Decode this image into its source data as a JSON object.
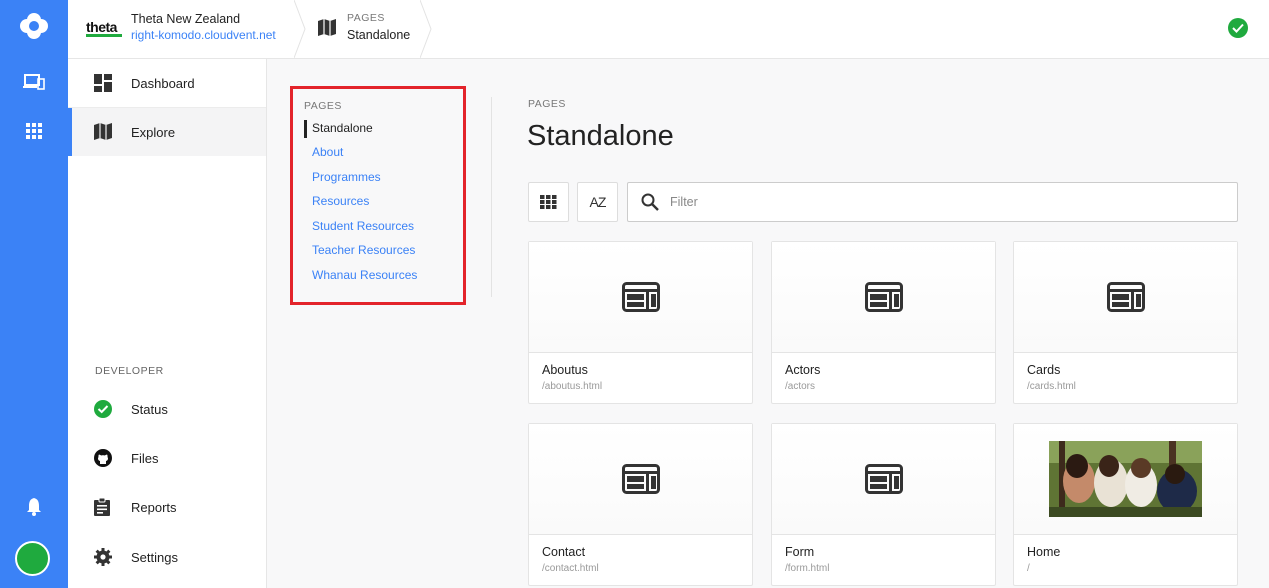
{
  "topbar": {
    "logo_text": "theta",
    "org_name": "Theta New Zealand",
    "org_host": "right-komodo.cloudvent.net",
    "crumb_caption": "PAGES",
    "crumb_title": "Standalone"
  },
  "nav": {
    "dashboard": "Dashboard",
    "explore": "Explore",
    "developer_caption": "DEVELOPER",
    "status": "Status",
    "files": "Files",
    "reports": "Reports",
    "settings": "Settings"
  },
  "tree": {
    "caption": "PAGES",
    "items": [
      "Standalone",
      "About",
      "Programmes",
      "Resources",
      "Student Resources",
      "Teacher Resources",
      "Whanau Resources"
    ]
  },
  "main": {
    "caption": "PAGES",
    "title": "Standalone",
    "filter_placeholder": "Filter",
    "sort_label": "AZ"
  },
  "cards": [
    {
      "title": "Aboutus",
      "path": "/aboutus.html",
      "thumb": "layout-icon"
    },
    {
      "title": "Actors",
      "path": "/actors",
      "thumb": "layout-icon"
    },
    {
      "title": "Cards",
      "path": "/cards.html",
      "thumb": "layout-icon"
    },
    {
      "title": "Contact",
      "path": "/contact.html",
      "thumb": "layout-icon"
    },
    {
      "title": "Form",
      "path": "/form.html",
      "thumb": "layout-icon"
    },
    {
      "title": "Home",
      "path": "/",
      "thumb": "photo"
    }
  ],
  "colors": {
    "brand_blue": "#3b82f6",
    "status_green": "#1faa3e",
    "highlight_red": "#e3242b"
  }
}
